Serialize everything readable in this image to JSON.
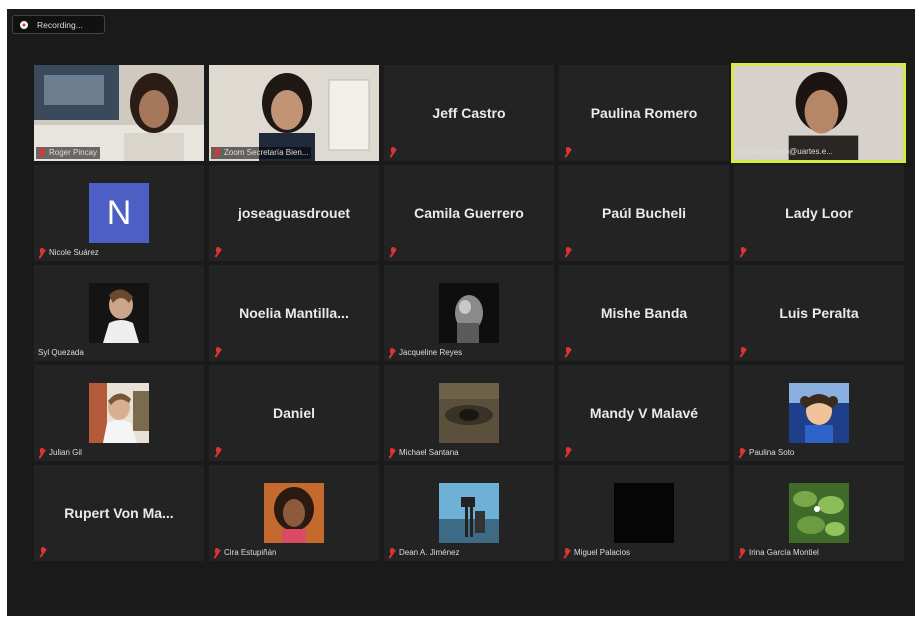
{
  "recording": {
    "label": "Recording..."
  },
  "participants": [
    {
      "name": "Roger Pincay",
      "kind": "video"
    },
    {
      "name": "Zoom Secretaría Bien...",
      "kind": "video"
    },
    {
      "name": "Jeff Castro",
      "kind": "name"
    },
    {
      "name": "Paulina Romero",
      "kind": "name"
    },
    {
      "name": "damian.rosero@uartes.e...",
      "kind": "video",
      "active": true
    },
    {
      "name": "Nicole Suárez",
      "kind": "avatar",
      "avatar_letter": "N"
    },
    {
      "name": "joseaguasdrouet",
      "kind": "name"
    },
    {
      "name": "Camila Guerrero",
      "kind": "name"
    },
    {
      "name": "Paúl Bucheli",
      "kind": "name"
    },
    {
      "name": "Lady Loor",
      "kind": "name"
    },
    {
      "name": "Syl Quezada",
      "kind": "photo"
    },
    {
      "name": "Noelia  Mantilla...",
      "kind": "name"
    },
    {
      "name": "Jacqueline Reyes",
      "kind": "photo"
    },
    {
      "name": "Mishe Banda",
      "kind": "name"
    },
    {
      "name": "Luis Peralta",
      "kind": "name"
    },
    {
      "name": "Julian Gil",
      "kind": "photo"
    },
    {
      "name": "Daniel",
      "kind": "name"
    },
    {
      "name": "Michael Santana",
      "kind": "photo"
    },
    {
      "name": "Mandy V Malavé",
      "kind": "name"
    },
    {
      "name": "Paulina Soto",
      "kind": "photo"
    },
    {
      "name": "Rupert Von Ma...",
      "kind": "name"
    },
    {
      "name": "Cira Estupiñán",
      "kind": "photo"
    },
    {
      "name": "Dean A. Jiménez",
      "kind": "photo"
    },
    {
      "name": "Miguel Palacios",
      "kind": "photo"
    },
    {
      "name": "Irina García Montiel",
      "kind": "photo"
    }
  ],
  "colors": {
    "background": "#1a1a1a",
    "tile": "#232323",
    "active_border": "#d8e94a",
    "muted_mic": "#d33"
  }
}
